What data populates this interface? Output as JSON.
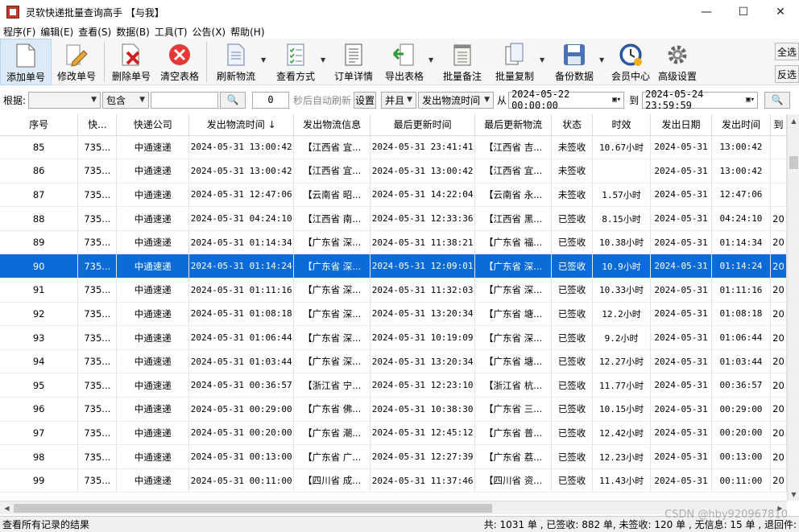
{
  "window": {
    "title": "灵软快递批量查询高手 【与我】",
    "min": "—",
    "max": "☐",
    "close": "✕"
  },
  "menu": [
    "程序(F)",
    "编辑(E)",
    "查看(S)",
    "数据(B)",
    "工具(T)",
    "公告(X)",
    "帮助(H)"
  ],
  "toolbar": {
    "add": "添加单号",
    "edit": "修改单号",
    "delete": "删除单号",
    "clear": "清空表格",
    "refresh": "刷新物流",
    "view": "查看方式",
    "detail": "订单详情",
    "export": "导出表格",
    "batch_note": "批量备注",
    "batch_copy": "批量复制",
    "backup": "备份数据",
    "member": "会员中心",
    "advanced": "高级设置",
    "select_all": "全选",
    "invert": "反选"
  },
  "filter": {
    "label": "根据:",
    "field_value": "",
    "mode": "包含",
    "keyword": "",
    "search_glyph": "🔍",
    "seconds": "0",
    "auto_refresh": "秒后自动刷新",
    "settings": "设置",
    "logic": "并且",
    "date_field": "发出物流时间",
    "from_label": "从",
    "from": "2024-05-22 00:00:00",
    "to_label": "到",
    "to": "2024-05-24 23:59:59"
  },
  "columns": [
    "序号",
    "快...",
    "快递公司",
    "发出物流时间 ↓",
    "发出物流信息",
    "最后更新时间",
    "最后更新物流",
    "状态",
    "时效",
    "发出日期",
    "发出时间",
    "到"
  ],
  "rows": [
    [
      "85",
      "735...",
      "中通速递",
      "2024-05-31 13:00:42",
      "【江西省 宜...",
      "2024-05-31 23:41:41",
      "【江西省 吉...",
      "未签收",
      "10.67小时",
      "2024-05-31",
      "13:00:42",
      ""
    ],
    [
      "86",
      "735...",
      "中通速递",
      "2024-05-31 13:00:42",
      "【江西省 宜...",
      "2024-05-31 13:00:42",
      "【江西省 宜...",
      "未签收",
      "",
      "2024-05-31",
      "13:00:42",
      ""
    ],
    [
      "87",
      "735...",
      "中通速递",
      "2024-05-31 12:47:06",
      "【云南省 昭...",
      "2024-05-31 14:22:04",
      "【云南省 永...",
      "未签收",
      "1.57小时",
      "2024-05-31",
      "12:47:06",
      ""
    ],
    [
      "88",
      "735...",
      "中通速递",
      "2024-05-31 04:24:10",
      "【江西省 南...",
      "2024-05-31 12:33:36",
      "【江西省 黑...",
      "已签收",
      "8.15小时",
      "2024-05-31",
      "04:24:10",
      "20"
    ],
    [
      "89",
      "735...",
      "中通速递",
      "2024-05-31 01:14:34",
      "【广东省 深...",
      "2024-05-31 11:38:21",
      "【广东省 福...",
      "已签收",
      "10.38小时",
      "2024-05-31",
      "01:14:34",
      "20"
    ],
    [
      "90",
      "735...",
      "中通速递",
      "2024-05-31 01:14:24",
      "【广东省 深...",
      "2024-05-31 12:09:01",
      "【广东省 深...",
      "已签收",
      "10.9小时",
      "2024-05-31",
      "01:14:24",
      "20"
    ],
    [
      "91",
      "735...",
      "中通速递",
      "2024-05-31 01:11:16",
      "【广东省 深...",
      "2024-05-31 11:32:03",
      "【广东省 深...",
      "已签收",
      "10.33小时",
      "2024-05-31",
      "01:11:16",
      "20"
    ],
    [
      "92",
      "735...",
      "中通速递",
      "2024-05-31 01:08:18",
      "【广东省 深...",
      "2024-05-31 13:20:34",
      "【广东省 塘...",
      "已签收",
      "12.2小时",
      "2024-05-31",
      "01:08:18",
      "20"
    ],
    [
      "93",
      "735...",
      "中通速递",
      "2024-05-31 01:06:44",
      "【广东省 深...",
      "2024-05-31 10:19:09",
      "【广东省 深...",
      "已签收",
      "9.2小时",
      "2024-05-31",
      "01:06:44",
      "20"
    ],
    [
      "94",
      "735...",
      "中通速递",
      "2024-05-31 01:03:44",
      "【广东省 深...",
      "2024-05-31 13:20:34",
      "【广东省 塘...",
      "已签收",
      "12.27小时",
      "2024-05-31",
      "01:03:44",
      "20"
    ],
    [
      "95",
      "735...",
      "中通速递",
      "2024-05-31 00:36:57",
      "【浙江省 宁...",
      "2024-05-31 12:23:10",
      "【浙江省 杭...",
      "已签收",
      "11.77小时",
      "2024-05-31",
      "00:36:57",
      "20"
    ],
    [
      "96",
      "735...",
      "中通速递",
      "2024-05-31 00:29:00",
      "【广东省 佛...",
      "2024-05-31 10:38:30",
      "【广东省 三...",
      "已签收",
      "10.15小时",
      "2024-05-31",
      "00:29:00",
      "20"
    ],
    [
      "97",
      "735...",
      "中通速递",
      "2024-05-31 00:20:00",
      "【广东省 潮...",
      "2024-05-31 12:45:12",
      "【广东省 普...",
      "已签收",
      "12.42小时",
      "2024-05-31",
      "00:20:00",
      "20"
    ],
    [
      "98",
      "735...",
      "中通速递",
      "2024-05-31 00:13:00",
      "【广东省 广...",
      "2024-05-31 12:27:39",
      "【广东省 荔...",
      "已签收",
      "12.23小时",
      "2024-05-31",
      "00:13:00",
      "20"
    ],
    [
      "99",
      "735...",
      "中通速递",
      "2024-05-31 00:11:00",
      "【四川省 成...",
      "2024-05-31 11:37:46",
      "【四川省 资...",
      "已签收",
      "11.43小时",
      "2024-05-31",
      "00:11:00",
      "20"
    ]
  ],
  "selected_row": 5,
  "status": {
    "left": "查看所有记录的结果",
    "right": "共: 1031 单 , 已签收: 882 单, 未签收: 120 单 , 无信息: 15 单 , 退回件:"
  },
  "watermark": "CSDN @hby920967810",
  "colors": {
    "selection": "#0a6ad8",
    "toolbar_bg": "#f6f6f6"
  }
}
